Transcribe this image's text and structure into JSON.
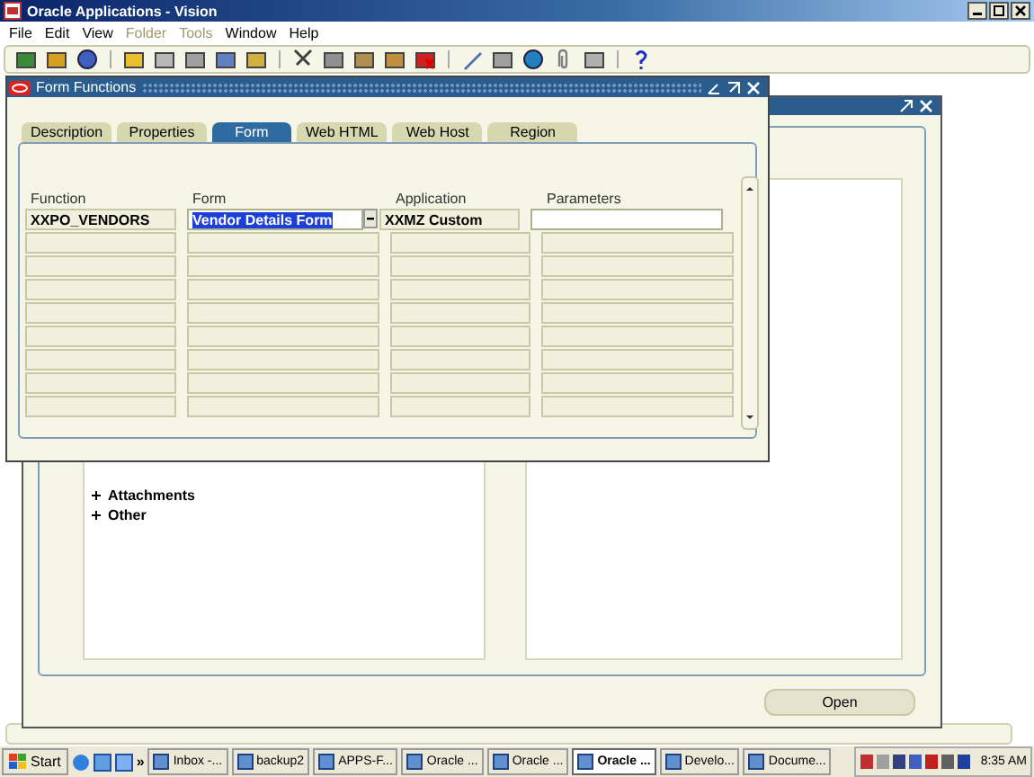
{
  "window": {
    "title": "Oracle Applications - Vision"
  },
  "menu": [
    {
      "label": "File",
      "disabled": false
    },
    {
      "label": "Edit",
      "disabled": false
    },
    {
      "label": "View",
      "disabled": false
    },
    {
      "label": "Folder",
      "disabled": true
    },
    {
      "label": "Tools",
      "disabled": true
    },
    {
      "label": "Window",
      "disabled": false
    },
    {
      "label": "Help",
      "disabled": false
    }
  ],
  "navigator": {
    "tree_items": [
      "Attachments",
      "Other"
    ],
    "open_button": "Open"
  },
  "form_functions": {
    "title": "Form Functions",
    "tabs": [
      {
        "label": "Description",
        "selected": false
      },
      {
        "label": "Properties",
        "selected": false
      },
      {
        "label": "Form",
        "selected": true
      },
      {
        "label": "Web HTML",
        "selected": false
      },
      {
        "label": "Web Host",
        "selected": false
      },
      {
        "label": "Region",
        "selected": false
      }
    ],
    "columns": [
      "Function",
      "Form",
      "Application",
      "Parameters"
    ],
    "record": {
      "function": "XXPO_VENDORS",
      "form": "Vendor Details Form",
      "form_highlighted": true,
      "application": "XXMZ Custom"
    }
  },
  "taskbar": {
    "start": "Start",
    "overflow": "»",
    "buttons": [
      {
        "label": "Inbox -...",
        "selected": false
      },
      {
        "label": "backup2",
        "selected": false
      },
      {
        "label": "APPS-F...",
        "selected": false
      },
      {
        "label": "Oracle ...",
        "selected": false
      },
      {
        "label": "Oracle ...",
        "selected": false
      },
      {
        "label": "Oracle ...",
        "selected": true
      },
      {
        "label": "Develo...",
        "selected": false
      },
      {
        "label": "Docume...",
        "selected": false
      }
    ],
    "clock": "8:35 AM"
  }
}
